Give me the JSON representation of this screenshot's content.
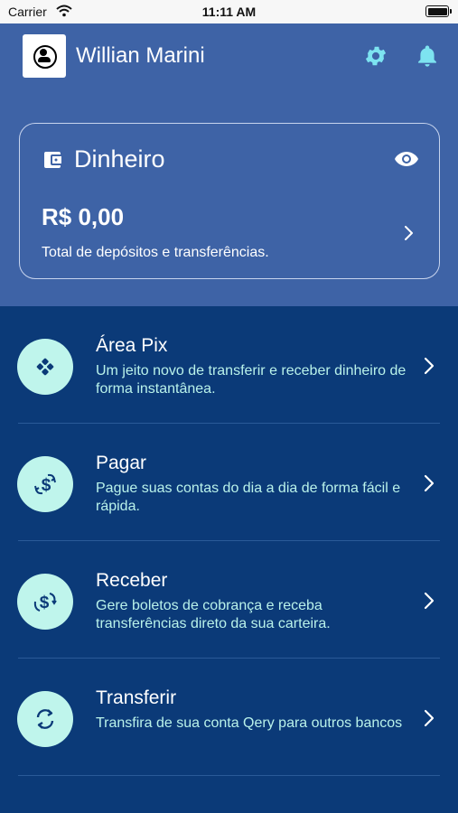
{
  "status_bar": {
    "carrier": "Carrier",
    "time": "11:11 AM"
  },
  "header": {
    "user_name": "Willian Marini"
  },
  "balance_card": {
    "title": "Dinheiro",
    "amount": "R$ 0,00",
    "subtitle": "Total de depósitos e transferências."
  },
  "menu": {
    "items": [
      {
        "title": "Área Pix",
        "description": "Um jeito novo de transferir e receber dinheiro de forma instantânea.",
        "icon": "pix-icon"
      },
      {
        "title": "Pagar",
        "description": "Pague suas contas do dia a dia de forma fácil e rápida.",
        "icon": "pay-icon"
      },
      {
        "title": "Receber",
        "description": "Gere boletos de cobrança e receba transferências direto da sua carteira.",
        "icon": "receive-icon"
      },
      {
        "title": "Transferir",
        "description": "Transfira de sua conta Qery para outros bancos",
        "icon": "transfer-icon"
      }
    ]
  },
  "colors": {
    "header_bg": "#3e63a6",
    "menu_bg": "#0b3a78",
    "accent": "#bff5ec",
    "icon_accent": "#7de3f0"
  }
}
